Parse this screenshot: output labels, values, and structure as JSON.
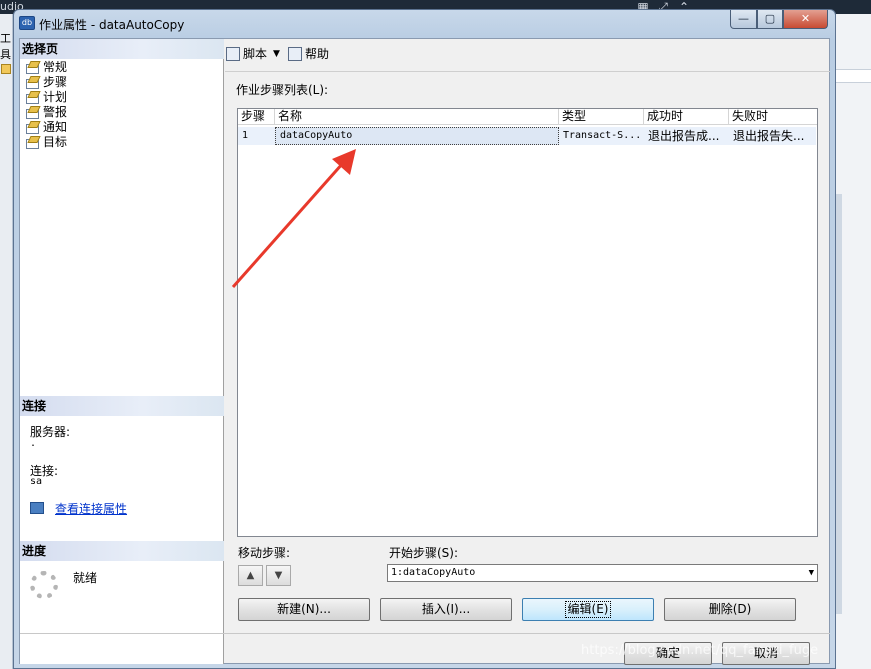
{
  "background": {
    "topleft_text": "udio",
    "side_text": "工具"
  },
  "window": {
    "title": "作业属性 - dataAutoCopy",
    "icon": "sql-job-icon",
    "controls": {
      "minimize": "—",
      "maximize": "▢",
      "close": "✕"
    }
  },
  "left_pane": {
    "select_page_header": "选择页",
    "pages": [
      "常规",
      "步骤",
      "计划",
      "警报",
      "通知",
      "目标"
    ],
    "connection_header": "连接",
    "server_label": "服务器:",
    "server_value": ".",
    "connection_label": "连接:",
    "connection_value": "sa",
    "view_connection_link": "查看连接属性",
    "progress_header": "进度",
    "progress_status": "就绪"
  },
  "toolbar": {
    "script_label": "脚本",
    "help_label": "帮助"
  },
  "steps": {
    "list_label": "作业步骤列表(L):",
    "columns": [
      "步骤",
      "名称",
      "类型",
      "成功时",
      "失败时"
    ],
    "rows": [
      {
        "step": "1",
        "name": "dataCopyAuto",
        "type": "Transact-S...",
        "on_success": "退出报告成...",
        "on_failure": "退出报告失..."
      }
    ],
    "move_label": "移动步骤:",
    "start_label": "开始步骤(S):",
    "start_value": "1:dataCopyAuto"
  },
  "buttons": {
    "new": "新建(N)...",
    "insert": "插入(I)...",
    "edit": "编辑(E)",
    "delete": "删除(D)",
    "ok": "确定",
    "cancel": "取消"
  },
  "watermark": "https://blog.csdn.net/qq_fangzi_fuge",
  "colors": {
    "arrow": "#e8392b",
    "accent": "#3c7fb1",
    "link": "#0033cc"
  }
}
